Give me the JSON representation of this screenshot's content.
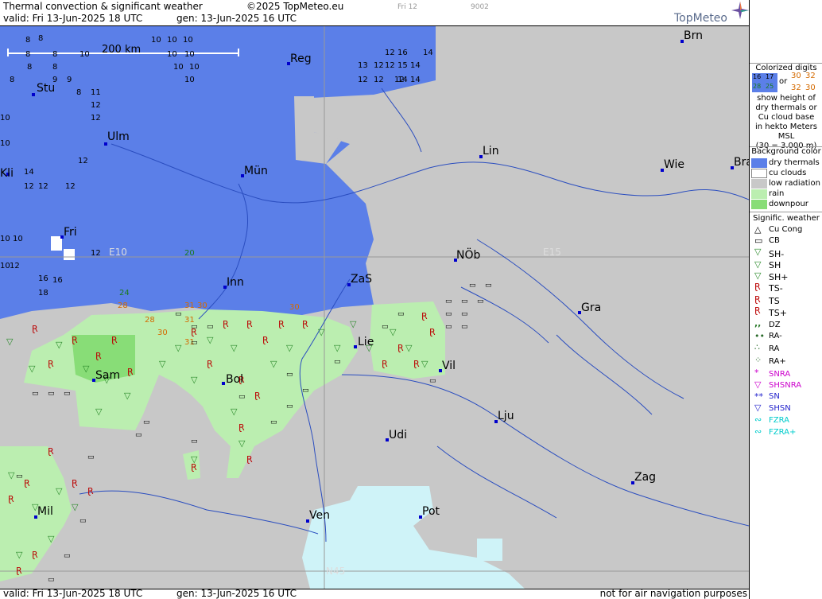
{
  "header": {
    "title": "Thermal convection & significant weather",
    "copyright": "©2025 TopMeteo.eu",
    "valid": "valid:  Fri  13-Jun-2025  18 UTC",
    "gen": "gen: 13-Jun-2025 16 UTC",
    "tab_day": "Fri 12",
    "tab_code": "9002",
    "brand": "TopMeteo"
  },
  "footer": {
    "valid": "valid:  Fri  13-Jun-2025  18 UTC",
    "gen": "gen: 13-Jun-2025 16 UTC",
    "disclaimer": "not for air navigation purposes"
  },
  "map": {
    "scale_label": "200 km",
    "grid_labels": {
      "e10": "E10",
      "e15": "E15",
      "n45": "N45"
    },
    "cities": [
      "Brn",
      "Reg",
      "Stu",
      "Ulm",
      "Lin",
      "Wie",
      "Bra",
      "Mün",
      "Kli",
      "Fri",
      "NÖb",
      "Inn",
      "ZaS",
      "Gra",
      "Lie",
      "Vil",
      "Sam",
      "Bol",
      "Lju",
      "Udi",
      "Zag",
      "Mil",
      "Ven",
      "Pot"
    ],
    "colors": {
      "dry": "#5b7fe8",
      "cu": "#ffffff",
      "low": "#c8c8c8",
      "rain": "#bbeeb0",
      "downpour": "#88dd77",
      "sea": "#cff3f8"
    }
  },
  "legend": {
    "digits_title": [
      "Colorized digits",
      "or",
      "show height of",
      "dry thermals or",
      "Cu cloud base",
      "in hekto Meters",
      "MSL",
      "(30 = 3.000 m)"
    ],
    "digits_examples": [
      "16",
      "17",
      "28",
      "25",
      "30",
      "32",
      "32",
      "30"
    ],
    "bg_title": "Background color",
    "bg_items": [
      "dry thermals",
      "cu clouds",
      "low radiation",
      "rain",
      "downpour"
    ],
    "sig_title": "Signific. weather",
    "sig_items": [
      "Cu Cong",
      "CB",
      "SH-",
      "SH",
      "SH+",
      "TS-",
      "TS",
      "TS+",
      "DZ",
      "RA-",
      "RA",
      "RA+",
      "SNRA",
      "SHSNRA",
      "SN",
      "SHSN",
      "FZRA",
      "FZRA+"
    ]
  }
}
